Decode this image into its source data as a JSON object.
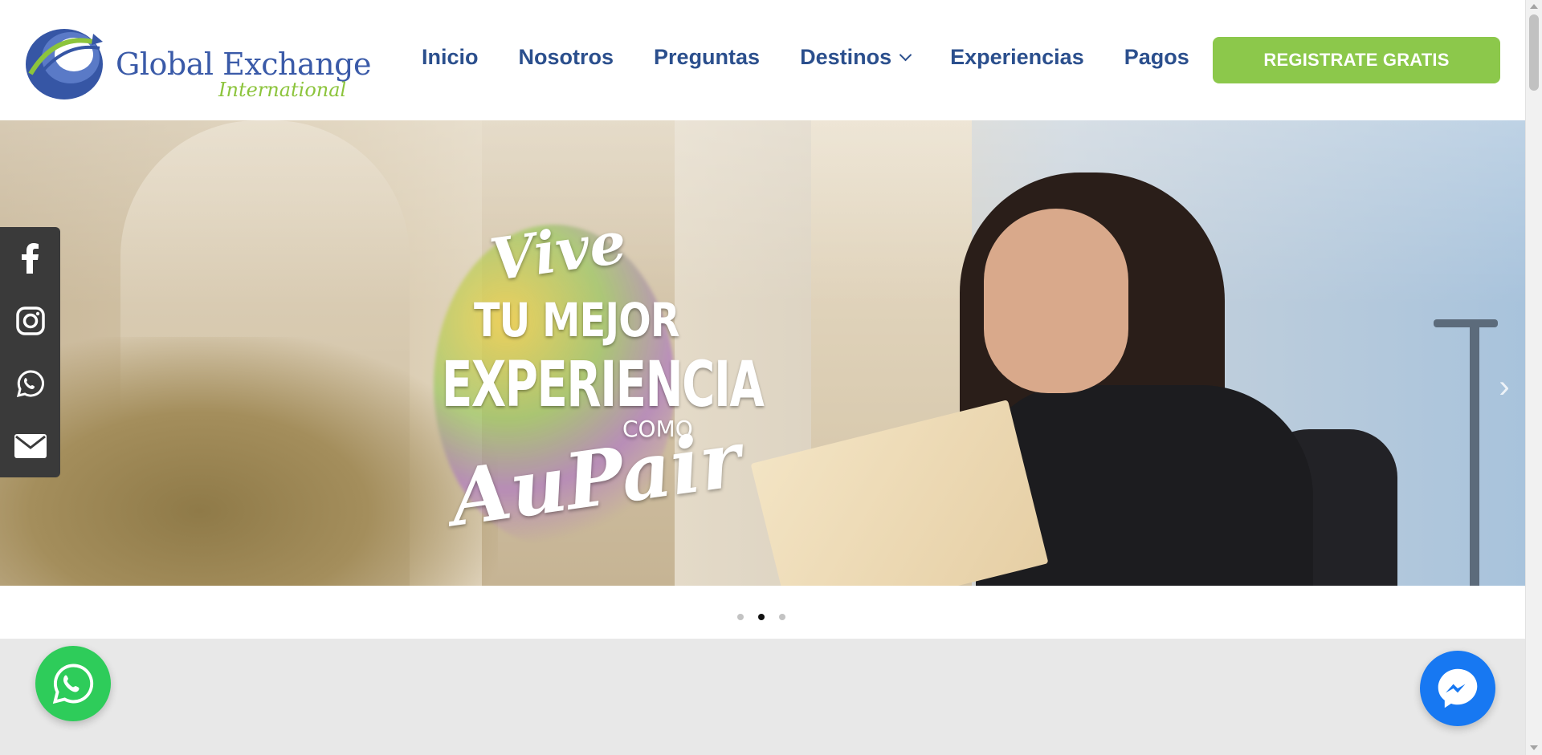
{
  "brand": {
    "name": "Global Exchange",
    "sub": "International",
    "colors": {
      "primary": "#2b4f8d",
      "accent": "#8cc84b"
    }
  },
  "nav": {
    "items": [
      {
        "label": "Inicio"
      },
      {
        "label": "Nosotros"
      },
      {
        "label": "Preguntas"
      },
      {
        "label": "Destinos",
        "has_dropdown": true
      },
      {
        "label": "Experiencias"
      },
      {
        "label": "Pagos"
      }
    ],
    "cta_label": "REGISTRATE GRATIS"
  },
  "hero": {
    "slogan": {
      "line1": "Vive",
      "line2": "TU MEJOR",
      "line3": "EXPERIENCIA",
      "line4": "COMO",
      "line5": "AuPair"
    },
    "slides_total": 3,
    "active_slide": 2,
    "next_icon": "chevron-right-icon"
  },
  "social": {
    "items": [
      {
        "icon": "facebook-icon"
      },
      {
        "icon": "instagram-icon"
      },
      {
        "icon": "whatsapp-icon"
      },
      {
        "icon": "envelope-icon"
      }
    ]
  },
  "floating": {
    "whatsapp_icon": "whatsapp-icon",
    "messenger_icon": "messenger-icon"
  }
}
